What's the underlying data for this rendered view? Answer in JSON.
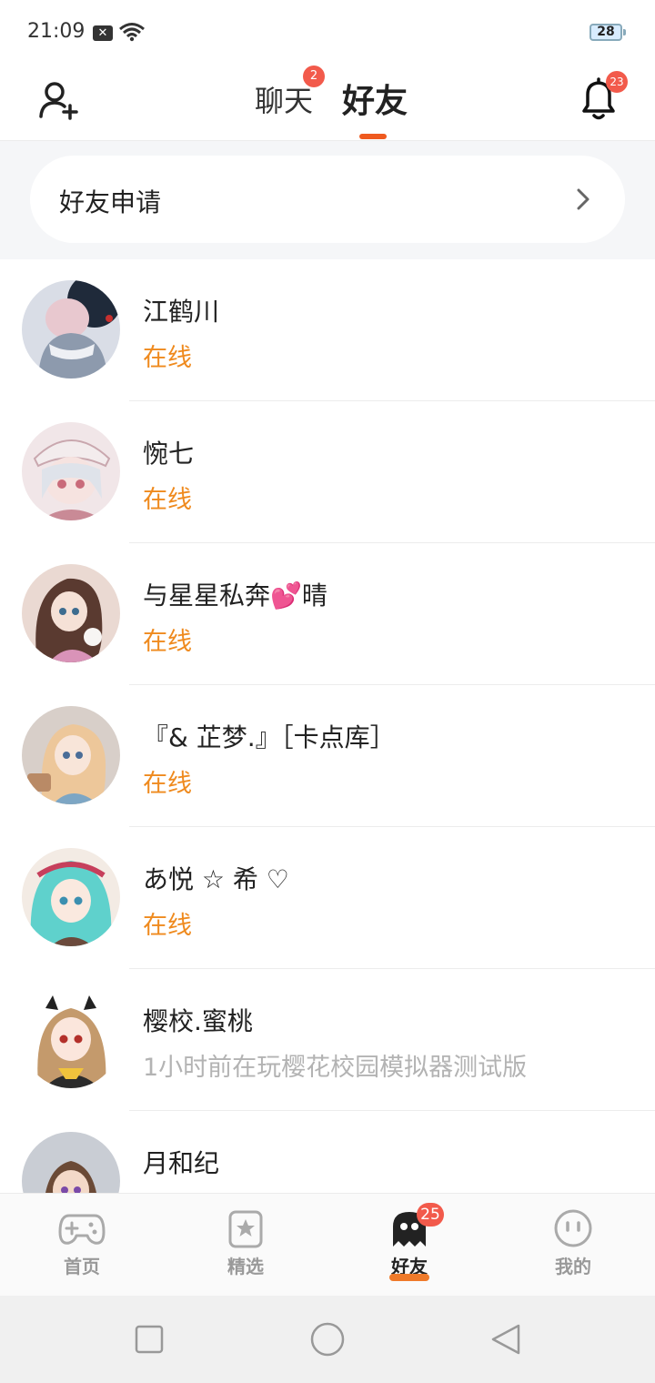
{
  "status_bar": {
    "time": "21:09",
    "battery": "28"
  },
  "header": {
    "tabs": [
      {
        "label": "聊天",
        "badge": "2"
      },
      {
        "label": "好友"
      }
    ],
    "notification_badge": "23",
    "accent_color": "#ef5a1f"
  },
  "friend_request": {
    "label": "好友申请"
  },
  "friends": [
    {
      "name": "江鹤川",
      "status": "在线"
    },
    {
      "name": "惋七",
      "status": "在线"
    },
    {
      "name": "与星星私奔💕晴",
      "status": "在线"
    },
    {
      "name": "『& 芷梦.』［卡点库］",
      "status": "在线"
    },
    {
      "name": "あ悦 ☆ 希 ♡",
      "status": "在线"
    },
    {
      "name": "樱校.蜜桃",
      "status": "1小时前在玩樱花校园模拟器测试版"
    },
    {
      "name": "月和纪",
      "status": ""
    }
  ],
  "bottom_nav": {
    "items": [
      {
        "label": "首页",
        "icon": "gamepad-icon"
      },
      {
        "label": "精选",
        "icon": "star-bookmark-icon"
      },
      {
        "label": "好友",
        "icon": "ghost-icon",
        "badge": "25"
      },
      {
        "label": "我的",
        "icon": "face-icon"
      }
    ]
  },
  "colors": {
    "online": "#ef8a1e",
    "offline": "#b3b3b3",
    "badge": "#f25a4b"
  }
}
